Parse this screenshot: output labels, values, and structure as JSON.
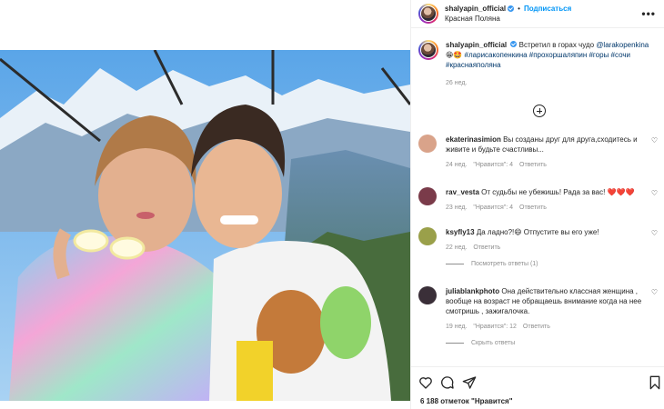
{
  "post": {
    "username": "shalyapin_official",
    "follow_label": "Подписаться",
    "separator": "•",
    "location": "Красная Поляна",
    "more_label": "•••"
  },
  "caption": {
    "username": "shalyapin_official",
    "text": "Встретил в горах чудо",
    "mention": "@larakopenkina",
    "emoji": "😁🤩",
    "hashtags": "#ларисакопенкина #прохоршаляпин #горы #сочи #краснаяполяна",
    "time": "26 нед."
  },
  "comments": [
    {
      "username": "ekaterinasimion",
      "text": "Вы созданы друг для друга,сходитесь и живите и будьте счастливы...",
      "time": "24 нед.",
      "likes": "\"Нравится\": 4",
      "reply": "Ответить",
      "avatar_color": "#d9a38a"
    },
    {
      "username": "rav_vesta",
      "text": "От судьбы не убежишь! Рада за вас! ❤️❤️❤️",
      "time": "23 нед.",
      "likes": "\"Нравится\": 4",
      "reply": "Ответить",
      "avatar_color": "#7a3b4a"
    },
    {
      "username": "ksyfly13",
      "text": "Да ладно?!😄 Отпустите вы его уже!",
      "time": "22 нед.",
      "reply": "Ответить",
      "view_replies": "Посмотреть ответы (1)",
      "avatar_color": "#9aa04a"
    },
    {
      "username": "juliablankphoto",
      "text": "Она действительно классная женщина , вообще на возраст не обращаешь внимание когда на нее смотришь , зажигалочка.",
      "time": "19 нед.",
      "likes": "\"Нравится\": 12",
      "reply": "Ответить",
      "hide_replies": "Скрыть ответы",
      "avatar_color": "#3a2f38"
    }
  ],
  "actions": {
    "likes_count": "6 188 отметок \"Нравится\""
  },
  "icons": [
    "heart-icon",
    "comment-icon",
    "share-icon",
    "save-icon",
    "add-comment-icon",
    "more-icon",
    "verified-icon"
  ]
}
